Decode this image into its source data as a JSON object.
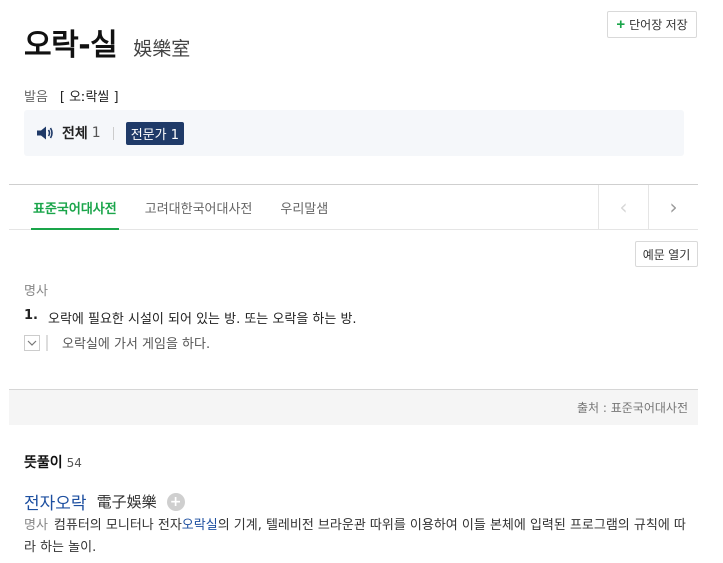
{
  "header": {
    "save_label": "단어장 저장",
    "title": "오락-실",
    "hanja": "娛樂室"
  },
  "pronunciation": {
    "label": "발음",
    "value": "[ 오ː락씰 ]"
  },
  "audio": {
    "all_label": "전체",
    "all_count": "1",
    "expert_label": "전문가 1"
  },
  "tabs": [
    {
      "label": "표준국어대사전",
      "active": true
    },
    {
      "label": "고려대한국어대사전",
      "active": false
    },
    {
      "label": "우리말샘",
      "active": false
    }
  ],
  "nav": {
    "prev": "‹",
    "next": "›"
  },
  "examples_button": "예문 열기",
  "entry": {
    "pos": "명사",
    "definition_num": "1.",
    "definition": "오락에 필요한 시설이 되어 있는 방. 또는 오락을 하는 방.",
    "example": "오락실에 가서 게임을 하다."
  },
  "source": "출처 : 표준국어대사전",
  "meanings": {
    "title": "뜻풀이",
    "count": "54"
  },
  "related": {
    "word": "전자오락",
    "hanja": "電子娛樂",
    "pos": "명사",
    "def_before": "컴퓨터의 모니터나 전자",
    "def_highlight": "오락실",
    "def_after": "의 기계, 텔레비전 브라운관 따위를 이용하여 이들 본체에 입력된 프로그램의 규칙에 따라 하는 놀이."
  },
  "colors": {
    "accent_green": "#1aa54a",
    "expert_chip": "#1f3a68",
    "link_blue": "#1d4fa0"
  }
}
